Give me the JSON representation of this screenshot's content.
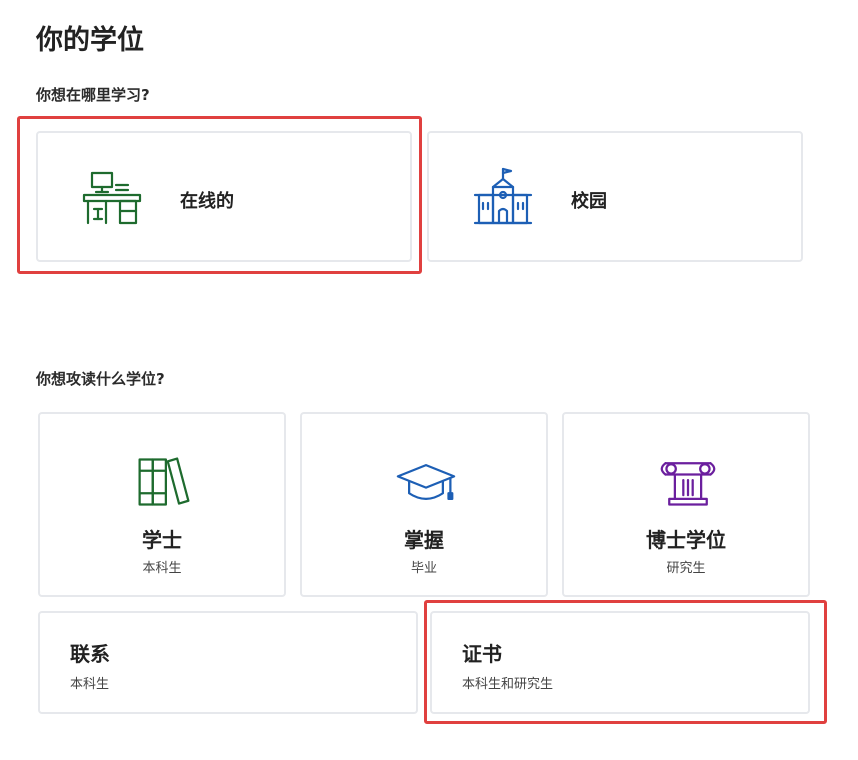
{
  "page": {
    "title": "你的学位"
  },
  "location": {
    "question": "你想在哪里学习?",
    "options": [
      {
        "label": "在线的",
        "icon": "online-desk-icon",
        "color": "#1e6b2e",
        "selected": true
      },
      {
        "label": "校园",
        "icon": "campus-building-icon",
        "color": "#1d5fb5",
        "selected": false
      }
    ]
  },
  "degree": {
    "question": "你想攻读什么学位?",
    "options": [
      {
        "title": "学士",
        "subtitle": "本科生",
        "icon": "books-icon",
        "color": "#1e6b2e"
      },
      {
        "title": "掌握",
        "subtitle": "毕业",
        "icon": "graduation-cap-icon",
        "color": "#1d5fb5"
      },
      {
        "title": "博士学位",
        "subtitle": "研究生",
        "icon": "column-icon",
        "color": "#6b1f9e"
      },
      {
        "title": "联系",
        "subtitle": "本科生"
      },
      {
        "title": "证书",
        "subtitle": "本科生和研究生",
        "selected": true
      }
    ]
  },
  "colors": {
    "highlight": "#e0403f",
    "card_border": "#e6e8ec"
  }
}
